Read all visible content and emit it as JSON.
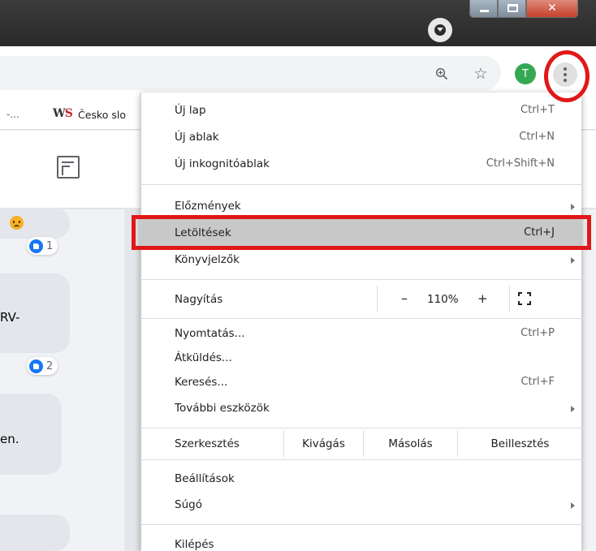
{
  "toolbar": {
    "profile_initial": "T"
  },
  "bookmarks": {
    "truncated": "-...",
    "ws_icon_left": "W",
    "ws_icon_right": "S",
    "item": "Česko slo"
  },
  "page": {
    "bubble_text_1": "RV-",
    "bubble_text_2": "en.",
    "reaction_1_count": "1",
    "reaction_2_count": "2"
  },
  "menu": {
    "new_tab": {
      "label": "Új lap",
      "shortcut": "Ctrl+T"
    },
    "new_window": {
      "label": "Új ablak",
      "shortcut": "Ctrl+N"
    },
    "new_incognito": {
      "label": "Új inkognitóablak",
      "shortcut": "Ctrl+Shift+N"
    },
    "history": {
      "label": "Előzmények"
    },
    "downloads": {
      "label": "Letöltések",
      "shortcut": "Ctrl+J"
    },
    "bookmarks": {
      "label": "Könyvjelzők"
    },
    "zoom": {
      "label": "Nagyítás",
      "minus": "–",
      "level": "110%",
      "plus": "+"
    },
    "print": {
      "label": "Nyomtatás...",
      "shortcut": "Ctrl+P"
    },
    "cast": {
      "label": "Átküldés..."
    },
    "find": {
      "label": "Keresés...",
      "shortcut": "Ctrl+F"
    },
    "more_tools": {
      "label": "További eszközök"
    },
    "edit": {
      "label": "Szerkesztés",
      "cut": "Kivágás",
      "copy": "Másolás",
      "paste": "Beillesztés"
    },
    "settings": {
      "label": "Beállítások"
    },
    "help": {
      "label": "Súgó"
    },
    "exit": {
      "label": "Kilépés"
    }
  },
  "colors": {
    "highlight": "#e01818",
    "hover_row": "#c8c8c8",
    "avatar": "#34a853"
  }
}
